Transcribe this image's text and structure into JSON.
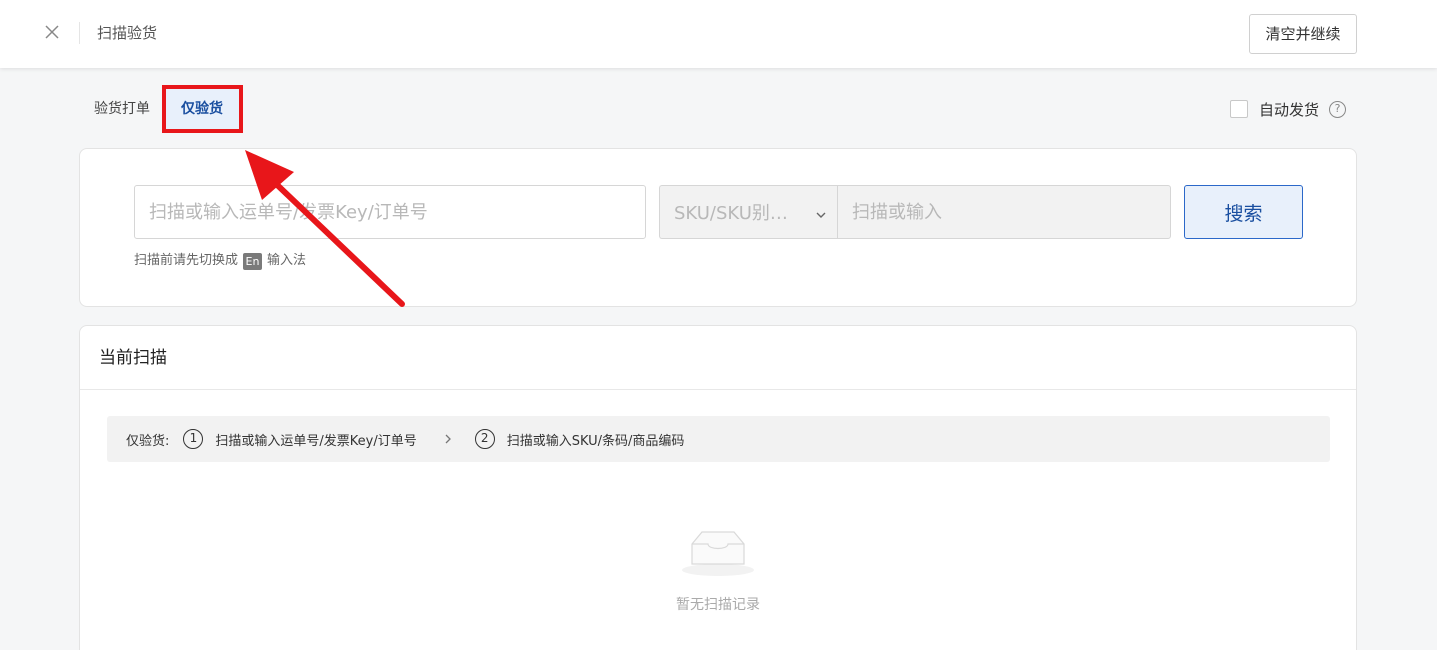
{
  "header": {
    "title": "扫描验货",
    "clear_button": "清空并继续"
  },
  "tabs": [
    {
      "label": "验货打单",
      "active": false
    },
    {
      "label": "仅验货",
      "active": true
    }
  ],
  "auto_ship": {
    "label": "自动发货",
    "checked": false
  },
  "scan": {
    "order_placeholder": "扫描或输入运单号/发票Key/订单号",
    "sku_select_value": "SKU/SKU别…",
    "sku_placeholder": "扫描或输入",
    "search_button": "搜索",
    "hint_prefix": "扫描前请先切换成",
    "hint_badge": "En",
    "hint_suffix": "输入法"
  },
  "current": {
    "title": "当前扫描",
    "steps_label": "仅验货:",
    "steps": [
      {
        "num": "1",
        "label": "扫描或输入运单号/发票Key/订单号"
      },
      {
        "num": "2",
        "label": "扫描或输入SKU/条码/商品编码"
      }
    ],
    "empty_text": "暂无扫描记录"
  },
  "colors": {
    "accent": "#1a4fa0",
    "annotation": "#e8161a"
  }
}
